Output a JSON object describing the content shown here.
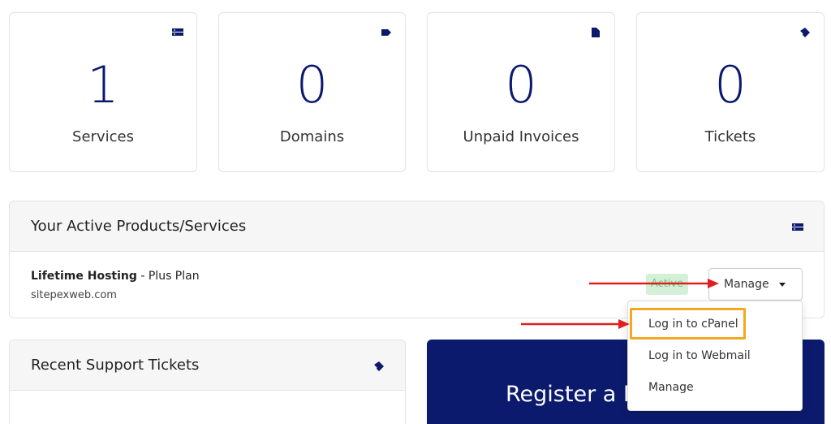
{
  "stats": [
    {
      "value": "1",
      "label": "Services",
      "icon": "server-icon"
    },
    {
      "value": "0",
      "label": "Domains",
      "icon": "tag-icon"
    },
    {
      "value": "0",
      "label": "Unpaid Invoices",
      "icon": "file-icon"
    },
    {
      "value": "0",
      "label": "Tickets",
      "icon": "ticket-icon"
    }
  ],
  "products_panel": {
    "title": "Your Active Products/Services",
    "service": {
      "name": "Lifetime Hosting",
      "plan": " - Plus Plan",
      "domain": "sitepexweb.com",
      "status": "Active"
    },
    "manage_label": "Manage",
    "dropdown_items": [
      "Log in to cPanel",
      "Log in to Webmail",
      "Manage"
    ]
  },
  "tickets_panel": {
    "title": "Recent Support Tickets"
  },
  "promo": {
    "text": "Register a N"
  },
  "colors": {
    "brand_navy": "#0b1a6d",
    "active_bg": "#d4f1d7",
    "active_text": "#7bc489",
    "highlight": "#f5a623",
    "arrow": "#e02020"
  }
}
